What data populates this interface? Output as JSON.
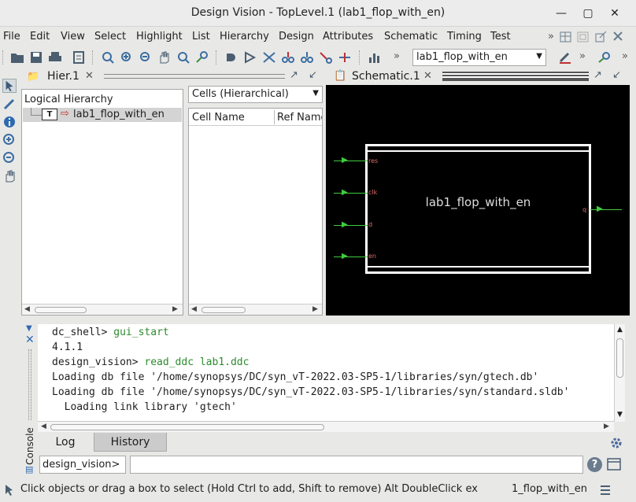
{
  "window": {
    "title": "Design Vision - TopLevel.1 (lab1_flop_with_en)"
  },
  "menus": [
    "File",
    "Edit",
    "View",
    "Select",
    "Highlight",
    "List",
    "Hierarchy",
    "Design",
    "Attributes",
    "Schematic",
    "Timing",
    "Test"
  ],
  "toolbar": {
    "design_select": "lab1_flop_with_en"
  },
  "hier": {
    "tab_label": "Hier.1",
    "tree_header": "Logical Hierarchy",
    "tree_item_badge": "T",
    "tree_item": "lab1_flop_with_en",
    "cells_select": "Cells (Hierarchical)",
    "col_cell_name": "Cell Name",
    "col_ref_name": "Ref Name"
  },
  "schematic": {
    "tab_label": "Schematic.1",
    "block_name": "lab1_flop_with_en",
    "inputs": [
      "res",
      "clk",
      "d",
      "en"
    ],
    "output": "q",
    "colors": {
      "background": "#000000",
      "wire": "#3fcc3f",
      "pin_label": "#e06a6a",
      "block": "#ffffff"
    }
  },
  "console": {
    "side_label": "Console",
    "lines": [
      {
        "prompt": "dc_shell> ",
        "cmd": "gui_start"
      },
      {
        "prompt": "4.1.1",
        "cmd": ""
      },
      {
        "prompt": "design_vision> ",
        "cmd": "read_ddc lab1.ddc"
      },
      {
        "prompt": "Loading db file '/home/synopsys/DC/syn_vT-2022.03-SP5-1/libraries/syn/gtech.db'",
        "cmd": ""
      },
      {
        "prompt": "Loading db file '/home/synopsys/DC/syn_vT-2022.03-SP5-1/libraries/syn/standard.sldb'",
        "cmd": ""
      },
      {
        "prompt": "  Loading link library 'gtech'",
        "cmd": ""
      }
    ],
    "tabs": [
      "Log",
      "History"
    ],
    "prompt_label": "design_vision>",
    "input_value": ""
  },
  "status": {
    "message": "Click objects or drag a box to select (Hold Ctrl to add, Shift to remove) Alt DoubleClick ex",
    "design": "1_flop_with_en"
  }
}
